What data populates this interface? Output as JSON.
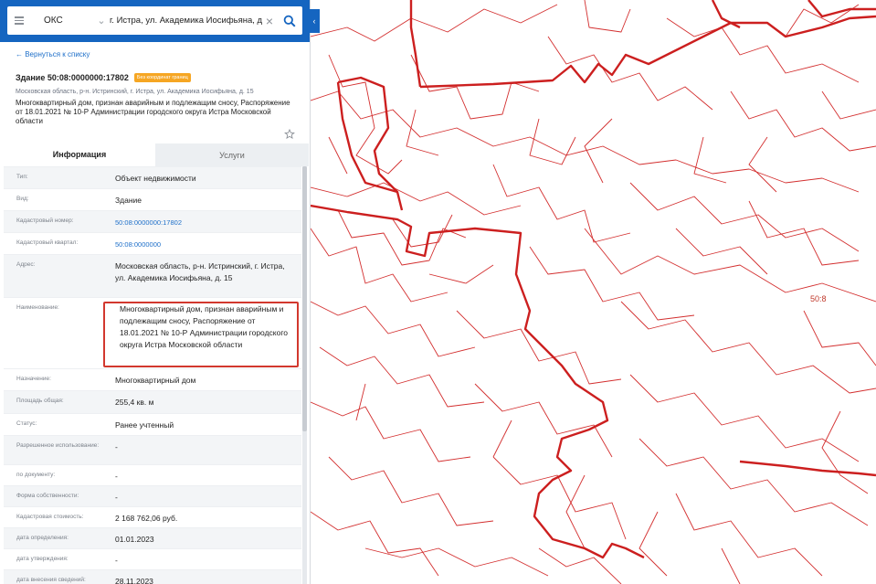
{
  "colors": {
    "accent": "#1565c0",
    "link": "#1e6fc9",
    "highlight": "#d2382e",
    "map_lines": "#d32f2f",
    "badge": "#f6a623"
  },
  "search": {
    "type_label": "ОКС",
    "query": "г. Истра, ул. Академика Иосифьяна, д. 15",
    "search_icon": "search-icon",
    "clear_icon": "close-icon",
    "menu_icon": "menu-icon"
  },
  "nav": {
    "back_label": "← Вернуться к списку"
  },
  "object": {
    "title": "Здание 50:08:0000000:17802",
    "badge": "Без координат границ",
    "address": "Московская область, р-н. Истринский, г. Истра, ул. Академика Иосифьяна, д. 15",
    "description": "Многоквартирный дом, признан аварийным и подлежащим сносу, Распоряжение от 18.01.2021 № 10-Р Администрации городского округа Истра Московской области"
  },
  "tabs": {
    "info": "Информация",
    "services": "Услуги"
  },
  "fields": [
    {
      "label": "Тип:",
      "value": "Объект недвижимости"
    },
    {
      "label": "Вид:",
      "value": "Здание"
    },
    {
      "label": "Кадастровый номер:",
      "value": "50:08:0000000:17802",
      "link": true
    },
    {
      "label": "Кадастровый квартал:",
      "value": "50:08:0000000",
      "link": true
    },
    {
      "label": "Адрес:",
      "value": "Московская область, р-н. Истринский, г. Истра, ул. Академика Иосифьяна, д. 15"
    },
    {
      "label": "Наименование:",
      "value": "Многоквартирный дом, признан аварийным и подлежащим сносу, Распоряжение от 18.01.2021 № 10-Р Администрации городского округа Истра Московской области"
    },
    {
      "label": "Назначение:",
      "value": "Многоквартирный дом"
    },
    {
      "label": "Площадь общая:",
      "value": "255,4 кв. м"
    },
    {
      "label": "Статус:",
      "value": "Ранее учтенный"
    },
    {
      "label": "Разрешенное использование:",
      "value": "-"
    },
    {
      "label": "по документу:",
      "value": "-"
    },
    {
      "label": "Форма собственности:",
      "value": "-"
    },
    {
      "label": "Кадастровая стоимость:",
      "value": "2 168 762,06 руб."
    },
    {
      "label": "дата определения:",
      "value": "01.01.2023"
    },
    {
      "label": "дата утверждения:",
      "value": "-"
    },
    {
      "label": "дата внесения сведений:",
      "value": "28.11.2023"
    }
  ],
  "map": {
    "label": "50:8"
  }
}
